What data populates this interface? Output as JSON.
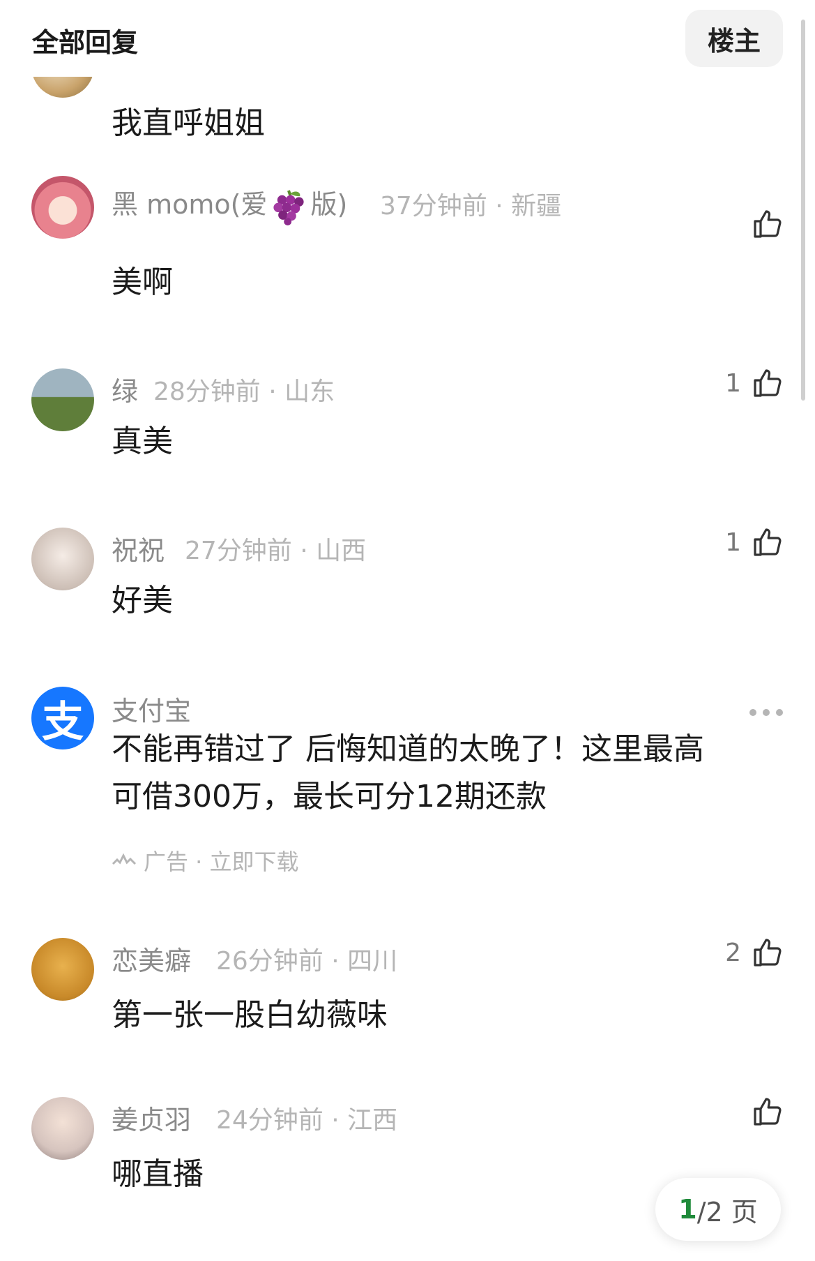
{
  "header": {
    "title": "全部回复",
    "op_button": "楼主"
  },
  "comments": [
    {
      "name": "",
      "time": "",
      "location": "",
      "content": "我直呼姐姐",
      "likes": ""
    },
    {
      "name_prefix": "黑 momo(爱",
      "name_emoji": "grape-emoji",
      "name_suffix": "版)",
      "time": "37分钟前",
      "location": "新疆",
      "content": "美啊",
      "likes": ""
    },
    {
      "name": "绿",
      "time": "28分钟前",
      "location": "山东",
      "content": "真美",
      "likes": "1"
    },
    {
      "name": "祝祝",
      "time": "27分钟前",
      "location": "山西",
      "content": "好美",
      "likes": "1"
    },
    {
      "name": "恋美癖",
      "time": "26分钟前",
      "location": "四川",
      "content": "第一张一股白幼薇味",
      "likes": "2"
    },
    {
      "name": "姜贞羽",
      "time": "24分钟前",
      "location": "江西",
      "content": "哪直播",
      "likes": ""
    }
  ],
  "ad": {
    "name": "支付宝",
    "avatar_glyph": "支",
    "content_line1": "不能再错过了 后悔知道的太晚了！这里最高",
    "content_line2": "可借300万，最长可分12期还款",
    "tag": "广告 · 立即下载"
  },
  "pager": {
    "current": "1",
    "rest": "/2 页"
  },
  "meta_separator": "·"
}
